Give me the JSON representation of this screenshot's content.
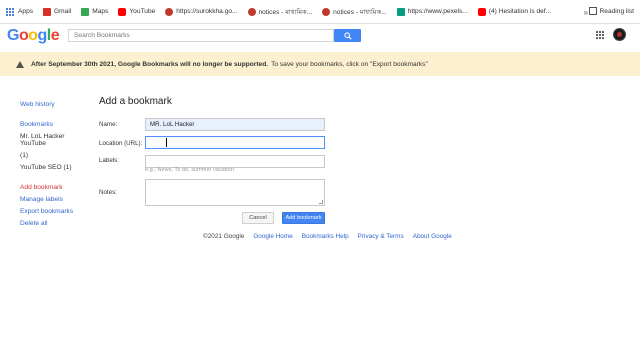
{
  "bookmarks_bar": {
    "items": [
      {
        "label": "Apps",
        "icon": "apps-grid-icon"
      },
      {
        "label": "Gmail",
        "icon": "gmail-icon",
        "color": "#d93025"
      },
      {
        "label": "Maps",
        "icon": "maps-icon",
        "color": "#34a853"
      },
      {
        "label": "YouTube",
        "icon": "youtube-icon",
        "color": "#ff0000"
      },
      {
        "label": "https://surokkha.go...",
        "icon": "site-icon",
        "color": "#c0392b"
      },
      {
        "label": "notices - মাধ্যমিক...",
        "icon": "site-icon",
        "color": "#c0392b"
      },
      {
        "label": "notices - মাধ্যমিক...",
        "icon": "site-icon",
        "color": "#c0392b"
      },
      {
        "label": "https://www.pexels...",
        "icon": "pexels-icon",
        "color": "#05a081"
      },
      {
        "label": "(4) Hesitation is def...",
        "icon": "youtube-icon",
        "color": "#ff0000"
      }
    ],
    "overflow": "»",
    "reading_list": "Reading list"
  },
  "header": {
    "logo": [
      "G",
      "o",
      "o",
      "g",
      "l",
      "e"
    ],
    "logo_colors": [
      "#4285f4",
      "#ea4335",
      "#fbbc05",
      "#4285f4",
      "#34a853",
      "#ea4335"
    ],
    "search_placeholder": "Search Bookmarks"
  },
  "banner": {
    "bold_text": "After September 30th 2021, Google Bookmarks will no longer be supported.",
    "text": "To save your bookmarks, click on \"Export bookmarks\""
  },
  "sidebar": {
    "web_history": "Web history",
    "bookmarks": "Bookmarks",
    "labels": [
      "Mr. LoL Hacker YouTube",
      "(1)",
      "YouTube SEO (1)"
    ],
    "add_bookmark": "Add bookmark",
    "manage_labels": "Manage labels",
    "export_bookmarks": "Export bookmarks",
    "delete_all": "Delete all"
  },
  "form": {
    "title": "Add a bookmark",
    "name_label": "Name:",
    "name_value": "MR. LoL Hacker",
    "location_label": "Location (URL):",
    "location_value": "",
    "labels_label": "Labels:",
    "labels_hint": "e.g., News, To do, summer vacation",
    "notes_label": "Notes:",
    "cancel": "Cancel",
    "add": "Add bookmark"
  },
  "footer": {
    "copyright": "©2021 Google",
    "links": [
      "Google Home",
      "Bookmarks Help",
      "Privacy & Terms",
      "About Google"
    ]
  }
}
